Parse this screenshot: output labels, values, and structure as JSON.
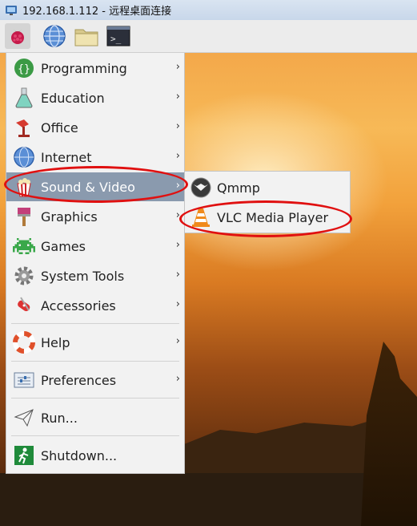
{
  "window": {
    "title": "192.168.1.112 - 远程桌面连接"
  },
  "panel": {
    "buttons": [
      {
        "name": "raspberry-menu",
        "icon": "raspberry-icon"
      },
      {
        "name": "web-browser",
        "icon": "globe-icon"
      },
      {
        "name": "file-manager",
        "icon": "folder-icon"
      },
      {
        "name": "terminal",
        "icon": "terminal-icon",
        "glyph": ">_"
      }
    ]
  },
  "menu": {
    "items": [
      {
        "label": "Programming",
        "icon": "programming-icon",
        "submenu": true
      },
      {
        "label": "Education",
        "icon": "flask-icon",
        "submenu": true
      },
      {
        "label": "Office",
        "icon": "office-icon",
        "submenu": true
      },
      {
        "label": "Internet",
        "icon": "globe-icon",
        "submenu": true
      },
      {
        "label": "Sound & Video",
        "icon": "popcorn-icon",
        "submenu": true,
        "selected": true
      },
      {
        "label": "Graphics",
        "icon": "paintbrush-icon",
        "submenu": true
      },
      {
        "label": "Games",
        "icon": "space-invader-icon",
        "submenu": true
      },
      {
        "label": "System Tools",
        "icon": "gear-icon",
        "submenu": true
      },
      {
        "label": "Accessories",
        "icon": "swiss-knife-icon",
        "submenu": true
      },
      {
        "label": "Help",
        "icon": "lifebuoy-icon",
        "submenu": true
      },
      {
        "label": "Preferences",
        "icon": "preferences-icon",
        "submenu": true
      },
      {
        "label": "Run...",
        "icon": "paper-plane-icon",
        "submenu": false
      },
      {
        "label": "Shutdown...",
        "icon": "exit-icon",
        "submenu": false
      }
    ],
    "arrow_glyph": "›"
  },
  "submenu": {
    "items": [
      {
        "label": "Qmmp",
        "icon": "qmmp-icon"
      },
      {
        "label": "VLC Media Player",
        "icon": "vlc-cone-icon"
      }
    ]
  },
  "colors": {
    "selected_bg": "#8a9aae",
    "menu_bg": "#f2f2f2",
    "annotation_red": "#e01010"
  }
}
